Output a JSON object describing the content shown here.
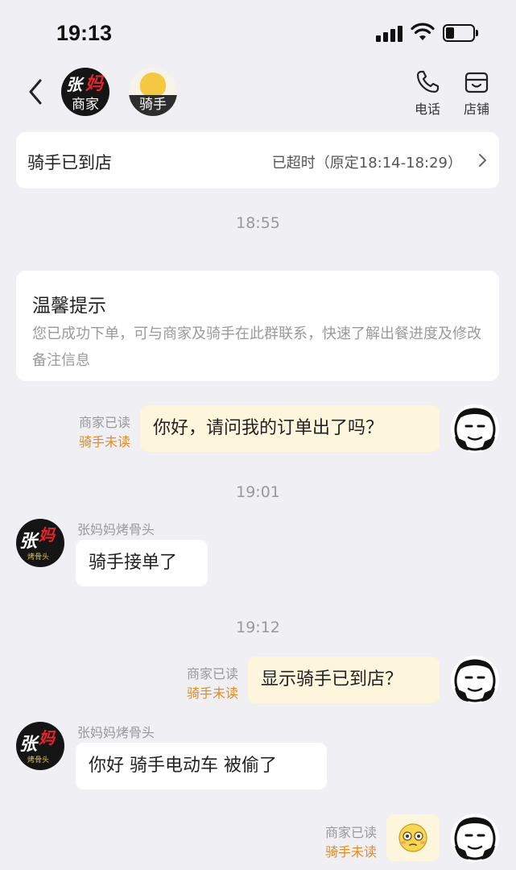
{
  "status_bar": {
    "time": "19:13",
    "battery_level": 0.3
  },
  "header": {
    "merchant_tag": "商家",
    "merchant_logo_text": "张妈妈",
    "rider_tag": "骑手",
    "phone_label": "电话",
    "store_label": "店铺"
  },
  "order_status": {
    "title": "骑手已到店",
    "overtime": "已超时（原定18:14-18:29）"
  },
  "times": {
    "t1": "18:55",
    "t2": "19:01",
    "t3": "19:12"
  },
  "tip": {
    "title": "温馨提示",
    "body": "您已成功下单，可与商家及骑手在此群联系，快速了解出餐进度及修改备注信息"
  },
  "read_labels": {
    "merchant_read": "商家已读",
    "rider_unread": "骑手未读"
  },
  "messages": {
    "m1": "你好，请问我的订单出了吗？",
    "shop_name": "张妈妈烤骨头",
    "m2": "骑手接单了",
    "m3": "显示骑手已到店？",
    "m4": "你好 骑手电动车 被偷了"
  }
}
